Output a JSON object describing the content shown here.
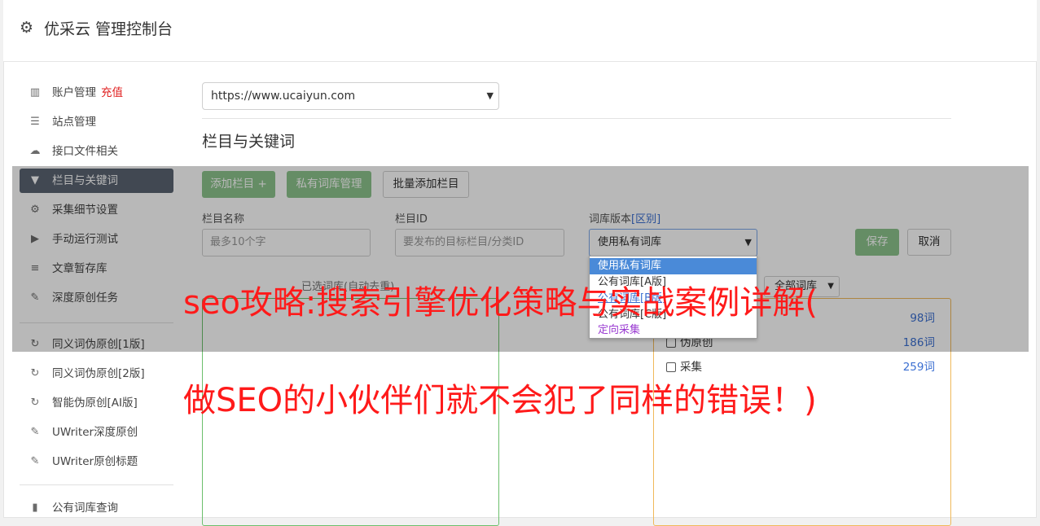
{
  "header": {
    "title": "优采云 管理控制台",
    "icon": "gear-icon"
  },
  "sidebar": {
    "items": [
      {
        "label": "账户管理",
        "extra": "充值",
        "icon": "bar-chart-icon"
      },
      {
        "label": "站点管理",
        "icon": "server-icon"
      },
      {
        "label": "接口文件相关",
        "icon": "cloud-upload-icon"
      },
      {
        "label": "栏目与关键词",
        "icon": "filter-icon"
      },
      {
        "label": "采集细节设置",
        "icon": "cogs-icon"
      },
      {
        "label": "手动运行测试",
        "icon": "play-icon"
      },
      {
        "label": "文章暂存库",
        "icon": "database-icon"
      },
      {
        "label": "深度原创任务",
        "icon": "edit-icon"
      },
      {
        "label": "同义词伪原创[1版]",
        "icon": "refresh-icon"
      },
      {
        "label": "同义词伪原创[2版]",
        "icon": "refresh-icon"
      },
      {
        "label": "智能伪原创[AI版]",
        "icon": "refresh-icon"
      },
      {
        "label": "UWriter深度原创",
        "icon": "edit-icon"
      },
      {
        "label": "UWriter原创标题",
        "icon": "edit-icon"
      },
      {
        "label": "公有词库查询",
        "icon": "book-icon"
      }
    ],
    "active_index": 3
  },
  "main": {
    "site_url": "https://www.ucaiyun.com",
    "section_title": "栏目与关键词",
    "buttons": {
      "add_column": "添加栏目 +",
      "private_lib": "私有词库管理",
      "batch_add": "批量添加栏目"
    },
    "form": {
      "column_name_label": "栏目名称",
      "column_name_placeholder": "最多10个字",
      "column_id_label": "栏目ID",
      "column_id_placeholder": "要发布的目标栏目/分类ID",
      "lib_version_label": "词库版本",
      "lib_version_link": "[区别]",
      "lib_version_value": "使用私有词库",
      "save": "保存",
      "cancel": "取消"
    },
    "dropdown_options": [
      "使用私有词库",
      "公有词库[A版]",
      "公有词库[B版]",
      "公有词库[C版]",
      "定向采集"
    ],
    "selected_caption": "已选词库(自动去重)",
    "all_lib_select": "全部词库",
    "libraries": [
      {
        "name": "",
        "count": "98词"
      },
      {
        "name": "伪原创",
        "count": "186词"
      },
      {
        "name": "采集",
        "count": "259词"
      }
    ]
  },
  "watermark": {
    "line1": "seo攻略:搜索引擎优化策略与实战案例详解(",
    "line2": "做SEO的小伙伴们就不会犯了同样的错误！)"
  }
}
